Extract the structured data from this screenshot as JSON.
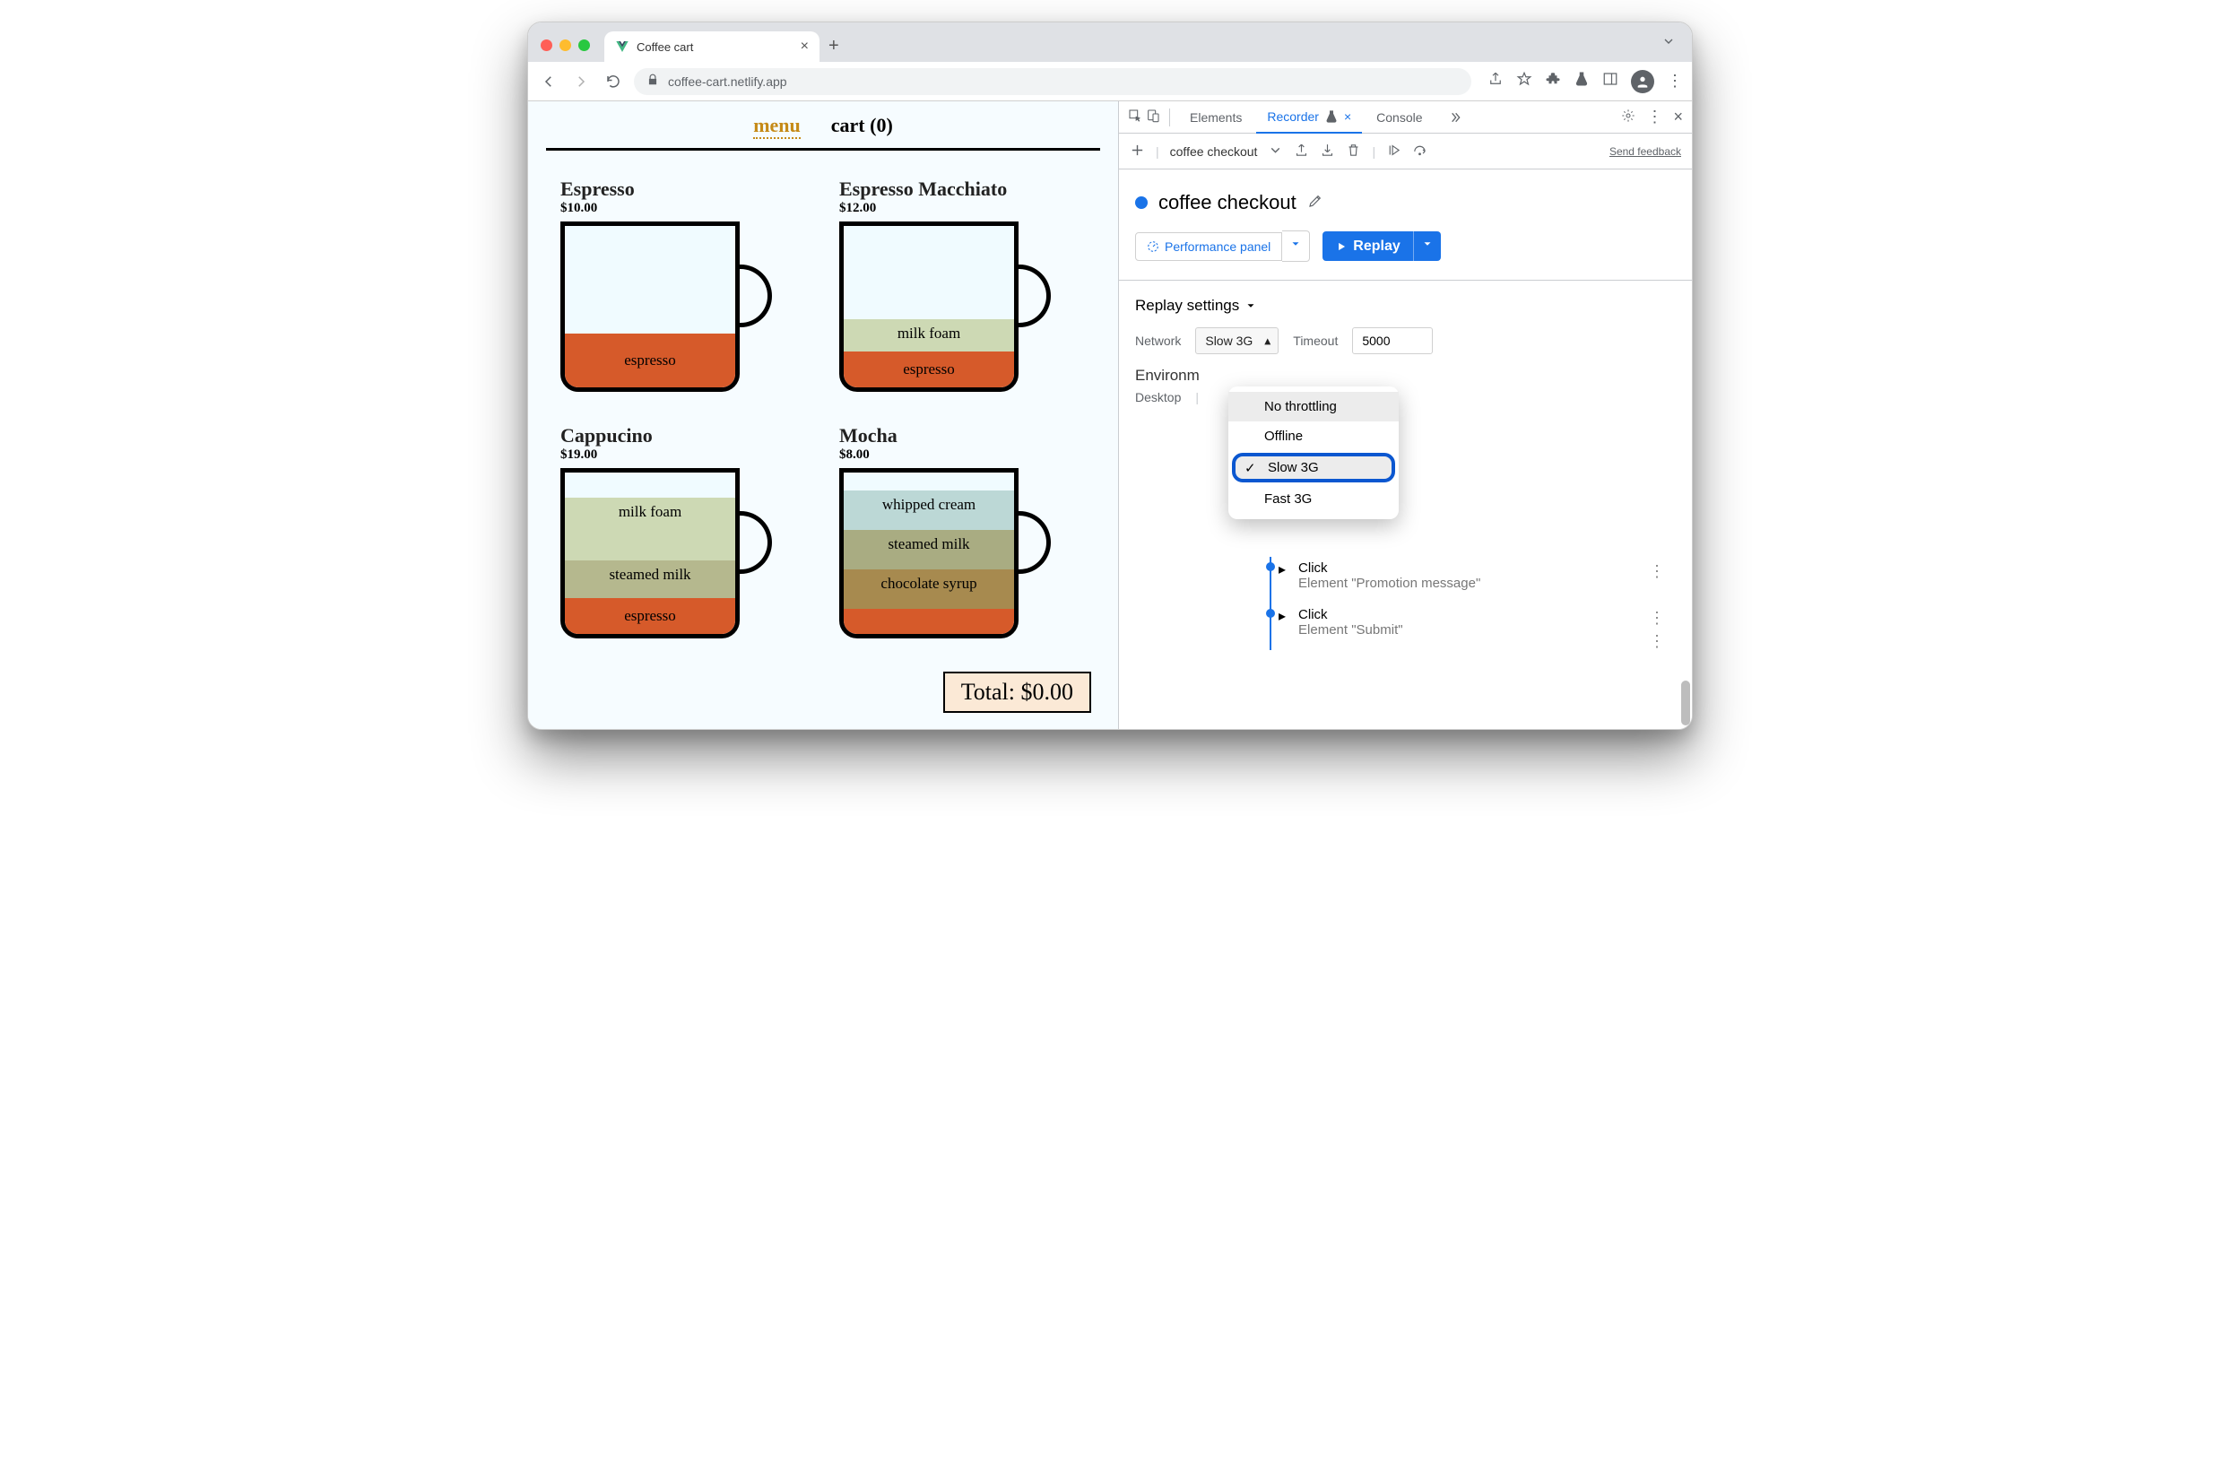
{
  "browser": {
    "tab_title": "Coffee cart",
    "url": "coffee-cart.netlify.app"
  },
  "page": {
    "nav": {
      "menu": "menu",
      "cart": "cart (0)"
    },
    "items": [
      {
        "name": "Espresso",
        "price": "$10.00",
        "layers": [
          {
            "label": "espresso",
            "cls": "l-espresso"
          }
        ]
      },
      {
        "name": "Espresso Macchiato",
        "price": "$12.00",
        "layers": [
          {
            "label": "milk foam",
            "cls": "l-milkfoam"
          },
          {
            "label": "espresso",
            "cls": "l-esp-thin"
          }
        ]
      },
      {
        "name": "Cappucino",
        "price": "$19.00",
        "layers": [
          {
            "label": "milk foam",
            "cls": "l-milkfoam",
            "h": 70
          },
          {
            "label": "steamed milk",
            "cls": "l-steamed"
          },
          {
            "label": "espresso",
            "cls": "l-esp-thin"
          }
        ]
      },
      {
        "name": "Mocha",
        "price": "$8.00",
        "layers": [
          {
            "label": "whipped cream",
            "cls": "l-cream"
          },
          {
            "label": "steamed milk",
            "cls": "l-steamed2"
          },
          {
            "label": "chocolate syrup",
            "cls": "l-choco"
          },
          {
            "label": "",
            "cls": "l-esp-tiny"
          }
        ]
      }
    ],
    "total_label": "Total: $0.00"
  },
  "devtools": {
    "tabs": {
      "elements": "Elements",
      "recorder": "Recorder",
      "console": "Console"
    },
    "toolbar": {
      "recording_name": "coffee checkout",
      "feedback": "Send feedback"
    },
    "recording_title": "coffee checkout",
    "perf_label": "Performance panel",
    "replay_label": "Replay",
    "settings": {
      "heading": "Replay settings",
      "network_label": "Network",
      "network_value": "Slow 3G",
      "timeout_label": "Timeout",
      "timeout_value": "5000",
      "env_heading": "Environm",
      "env_value": "Desktop"
    },
    "dropdown": {
      "opt1": "No throttling",
      "opt2": "Offline",
      "opt3": "Slow 3G",
      "opt4": "Fast 3G"
    },
    "steps": [
      {
        "title": "Click",
        "sub": "Element \"Promotion message\""
      },
      {
        "title": "Click",
        "sub": "Element \"Submit\""
      }
    ]
  }
}
